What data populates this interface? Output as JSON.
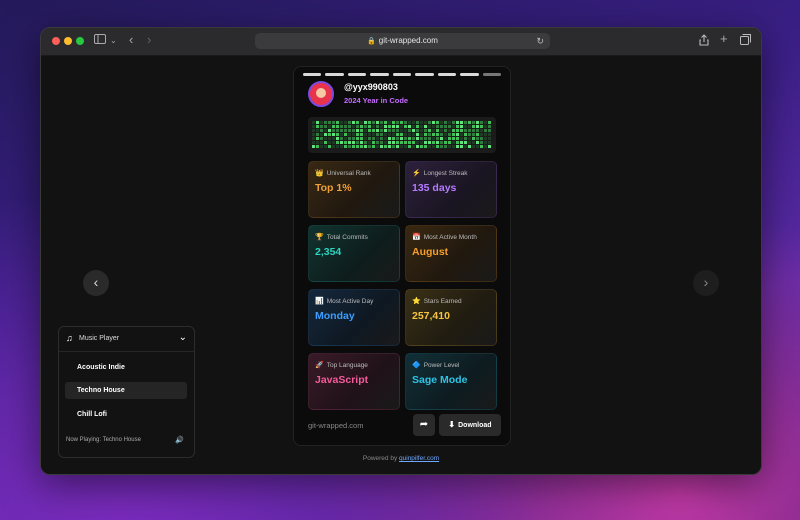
{
  "browser": {
    "url": "git-wrapped.com",
    "traffic_lights": [
      "#ff5f57",
      "#febc2e",
      "#28c840"
    ]
  },
  "profile": {
    "username": "@yyx990803",
    "subtitle": "2024 Year in Code"
  },
  "stats": [
    {
      "icon": "crown-icon",
      "glyph": "👑",
      "label": "Universal Rank",
      "value": "Top 1%",
      "color": "#f0a035"
    },
    {
      "icon": "lightning-icon",
      "glyph": "⚡",
      "label": "Longest Streak",
      "value": "135 days",
      "color": "#b57bff"
    },
    {
      "icon": "trophy-icon",
      "glyph": "🏆",
      "label": "Total Commits",
      "value": "2,354",
      "color": "#2dd4bf"
    },
    {
      "icon": "calendar-icon",
      "glyph": "📅",
      "label": "Most Active Month",
      "value": "August",
      "color": "#f59e2b"
    },
    {
      "icon": "chart-icon",
      "glyph": "📊",
      "label": "Most Active Day",
      "value": "Monday",
      "color": "#3b9eff"
    },
    {
      "icon": "star-icon",
      "glyph": "⭐",
      "label": "Stars Earned",
      "value": "257,410",
      "color": "#f5c542"
    },
    {
      "icon": "rocket-icon",
      "glyph": "🚀",
      "label": "Top Language",
      "value": "JavaScript",
      "color": "#f45b9a"
    },
    {
      "icon": "diamond-icon",
      "glyph": "🔷",
      "label": "Power Level",
      "value": "Sage Mode",
      "color": "#2dc4e8"
    }
  ],
  "card_footer": {
    "site": "git-wrapped.com",
    "download_label": "Download"
  },
  "powered": {
    "prefix": "Powered by",
    "link": "quinpilfer.com"
  },
  "music_player": {
    "title": "Music Player",
    "tracks": [
      "Acoustic Indie",
      "Techno House",
      "Chill Lofi"
    ],
    "active_track": "Techno House",
    "now_playing": "Now Playing: Techno House"
  }
}
